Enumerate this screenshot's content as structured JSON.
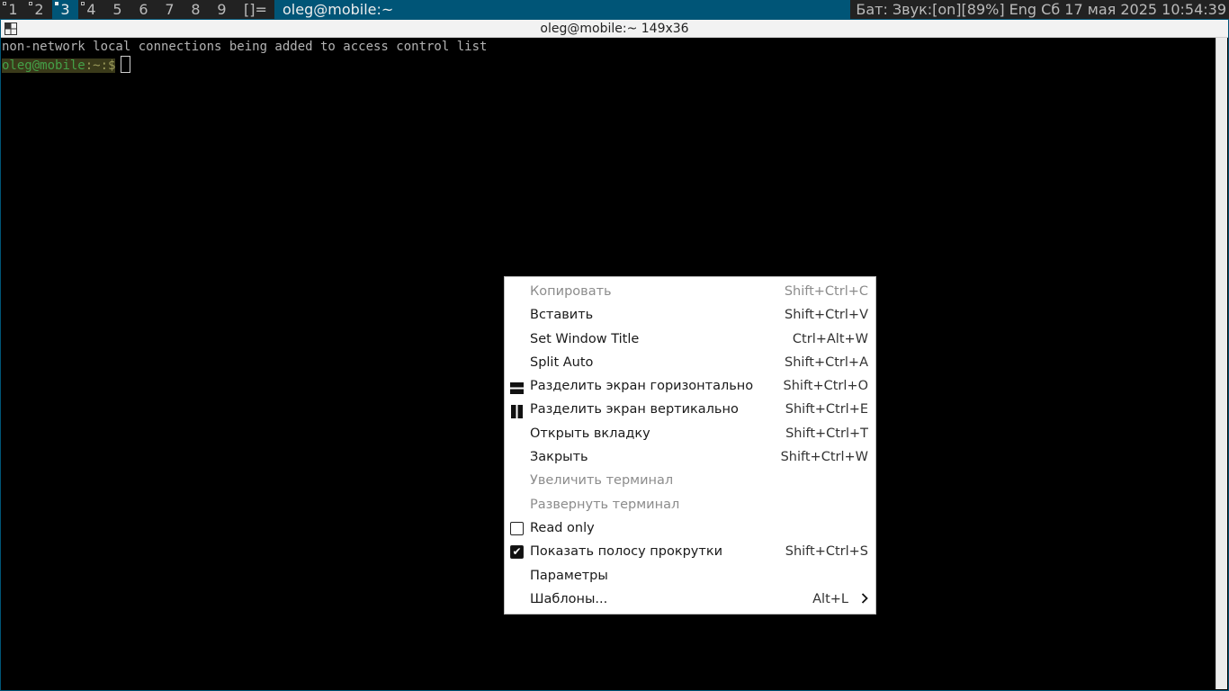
{
  "bar": {
    "tags": [
      {
        "label": "1",
        "occupied": true,
        "selected": false
      },
      {
        "label": "2",
        "occupied": true,
        "selected": false
      },
      {
        "label": "3",
        "occupied": true,
        "selected": true
      },
      {
        "label": "4",
        "occupied": true,
        "selected": false
      },
      {
        "label": "5",
        "occupied": false,
        "selected": false
      },
      {
        "label": "6",
        "occupied": false,
        "selected": false
      },
      {
        "label": "7",
        "occupied": false,
        "selected": false
      },
      {
        "label": "8",
        "occupied": false,
        "selected": false
      },
      {
        "label": "9",
        "occupied": false,
        "selected": false
      }
    ],
    "layout_symbol": "[]=",
    "window_title": "oleg@mobile:~",
    "status": "Бат: Звук:[on][89%] Eng Сб 17 мая 2025 10:54:39"
  },
  "terminal": {
    "title": "oleg@mobile:~ 149x36",
    "output_line": "non-network local connections being added to access control list",
    "prompt_user": "oleg",
    "prompt_at": "@",
    "prompt_host": "mobile",
    "prompt_path": ":~:$"
  },
  "context_menu": {
    "items": [
      {
        "label": "Копировать",
        "shortcut": "Shift+Ctrl+C",
        "disabled": true,
        "icon": ""
      },
      {
        "label": "Вставить",
        "shortcut": "Shift+Ctrl+V",
        "disabled": false,
        "icon": ""
      },
      {
        "label": "Set Window Title",
        "shortcut": "Ctrl+Alt+W",
        "disabled": false,
        "icon": ""
      },
      {
        "label": "Split Auto",
        "shortcut": "Shift+Ctrl+A",
        "disabled": false,
        "icon": ""
      },
      {
        "label": "Разделить экран горизонтально",
        "shortcut": "Shift+Ctrl+O",
        "disabled": false,
        "icon": "split-horizontal-icon"
      },
      {
        "label": "Разделить экран вертикально",
        "shortcut": "Shift+Ctrl+E",
        "disabled": false,
        "icon": "split-vertical-icon"
      },
      {
        "label": "Открыть вкладку",
        "shortcut": "Shift+Ctrl+T",
        "disabled": false,
        "icon": ""
      },
      {
        "label": "Закрыть",
        "shortcut": "Shift+Ctrl+W",
        "disabled": false,
        "icon": ""
      },
      {
        "label": "Увеличить терминал",
        "shortcut": "",
        "disabled": true,
        "icon": ""
      },
      {
        "label": "Развернуть терминал",
        "shortcut": "",
        "disabled": true,
        "icon": ""
      },
      {
        "label": "Read only",
        "shortcut": "",
        "disabled": false,
        "icon": "checkbox-unchecked-icon"
      },
      {
        "label": "Показать полосу прокрутки",
        "shortcut": "Shift+Ctrl+S",
        "disabled": false,
        "icon": "checkbox-checked-icon"
      },
      {
        "label": "Параметры",
        "shortcut": "",
        "disabled": false,
        "icon": ""
      },
      {
        "label": "Шаблоны...",
        "shortcut": "Alt+L",
        "disabled": false,
        "icon": "",
        "submenu": true
      }
    ]
  },
  "colors": {
    "bar_bg": "#222222",
    "bar_selected": "#005577",
    "terminal_bg": "#000000",
    "menu_bg": "#ffffff"
  }
}
